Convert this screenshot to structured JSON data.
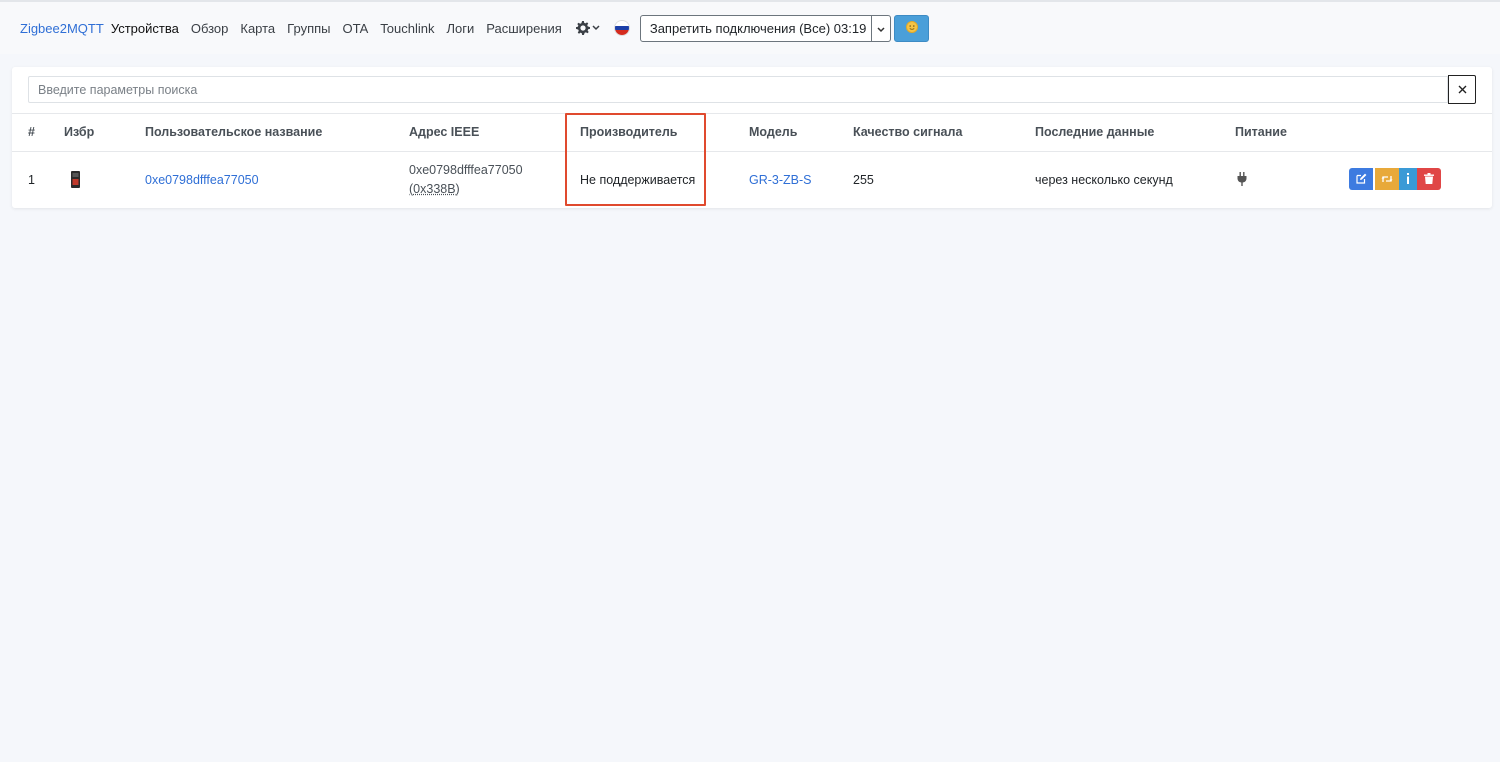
{
  "navbar": {
    "brand": "Zigbee2MQTT",
    "links": [
      "Устройства",
      "Обзор",
      "Карта",
      "Группы",
      "OTA",
      "Touchlink",
      "Логи",
      "Расширения"
    ],
    "permit_button": "Запретить подключения (Все) 03:19"
  },
  "search": {
    "placeholder": "Введите параметры поиска",
    "value": ""
  },
  "table": {
    "headers": [
      "#",
      "Избр",
      "Пользовательское название",
      "Адрес IEEE",
      "Производитель",
      "Модель",
      "Качество сигнала",
      "Последние данные",
      "Питание"
    ],
    "rows": [
      {
        "index": "1",
        "friendly_name": "0xe0798dfffea77050",
        "ieee": "0xe0798dfffea77050",
        "nwk": "(0x338B)",
        "manufacturer": "Не поддерживается",
        "model": "GR-3-ZB-S",
        "lqi": "255",
        "last_seen": "через несколько секунд"
      }
    ]
  },
  "colors": {
    "accent": "#2f6fd6",
    "highlight": "#e04a2e",
    "edit": "#3d7be0",
    "rename": "#e8a93a",
    "info": "#3a9ad6",
    "delete": "#e04646"
  },
  "icons": {
    "settings": "gear-icon",
    "language": "russia-flag-icon",
    "theme": "sun-icon",
    "clear": "close-icon",
    "power": "plug-icon"
  }
}
